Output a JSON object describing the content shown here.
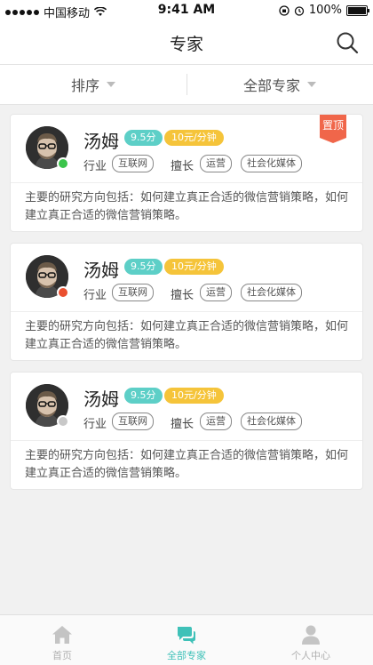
{
  "status_bar": {
    "carrier": "中国移动",
    "time": "9:41 AM",
    "battery": "100%"
  },
  "nav": {
    "title": "专家"
  },
  "filters": {
    "sort_label": "排序",
    "experts_label": "全部专家"
  },
  "experts": [
    {
      "name": "汤姆",
      "score": "9.5分",
      "price": "10元/分钟",
      "industry_label": "行业",
      "industry": "互联网",
      "skill_label": "擅长",
      "skills": [
        "运营",
        "社会化媒体"
      ],
      "status_color": "#3bc44b",
      "pinned": true,
      "pinned_label": "置顶",
      "description": "主要的研究方向包括：如何建立真正合适的微信营销策略，如何建立真正合适的微信营销策略。"
    },
    {
      "name": "汤姆",
      "score": "9.5分",
      "price": "10元/分钟",
      "industry_label": "行业",
      "industry": "互联网",
      "skill_label": "擅长",
      "skills": [
        "运营",
        "社会化媒体"
      ],
      "status_color": "#ea4f2f",
      "pinned": false,
      "description": "主要的研究方向包括：如何建立真正合适的微信营销策略，如何建立真正合适的微信营销策略。"
    },
    {
      "name": "汤姆",
      "score": "9.5分",
      "price": "10元/分钟",
      "industry_label": "行业",
      "industry": "互联网",
      "skill_label": "擅长",
      "skills": [
        "运营",
        "社会化媒体"
      ],
      "status_color": "#c8c8c8",
      "pinned": false,
      "description": "主要的研究方向包括：如何建立真正合适的微信营销策略，如何建立真正合适的微信营销策略。"
    }
  ],
  "tabbar": {
    "items": [
      {
        "label": "首页",
        "icon": "home-icon"
      },
      {
        "label": "全部专家",
        "icon": "chat-bubbles-icon",
        "active": true
      },
      {
        "label": "个人中心",
        "icon": "user-icon"
      }
    ]
  },
  "colors": {
    "accent": "#3fc1b8",
    "score_badge": "#5dcfc7",
    "price_badge": "#f5c43a",
    "pinned_badge": "#f0664a"
  }
}
